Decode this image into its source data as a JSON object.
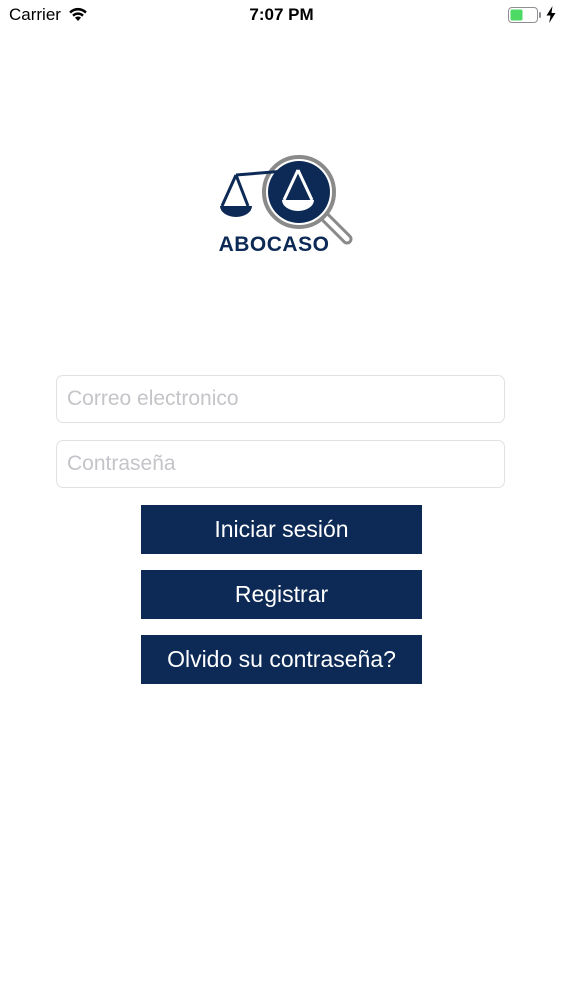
{
  "status_bar": {
    "carrier": "Carrier",
    "time": "7:07 PM",
    "battery_color": "#4cd964"
  },
  "logo": {
    "text": "ABOCASO",
    "color": "#0d2a56"
  },
  "form": {
    "email_placeholder": "Correo electronico",
    "email_value": "",
    "password_placeholder": "Contraseña",
    "password_value": ""
  },
  "buttons": {
    "login_label": "Iniciar sesión",
    "register_label": "Registrar",
    "forgot_label": "Olvido su contraseña?",
    "color": "#0d2a56"
  }
}
